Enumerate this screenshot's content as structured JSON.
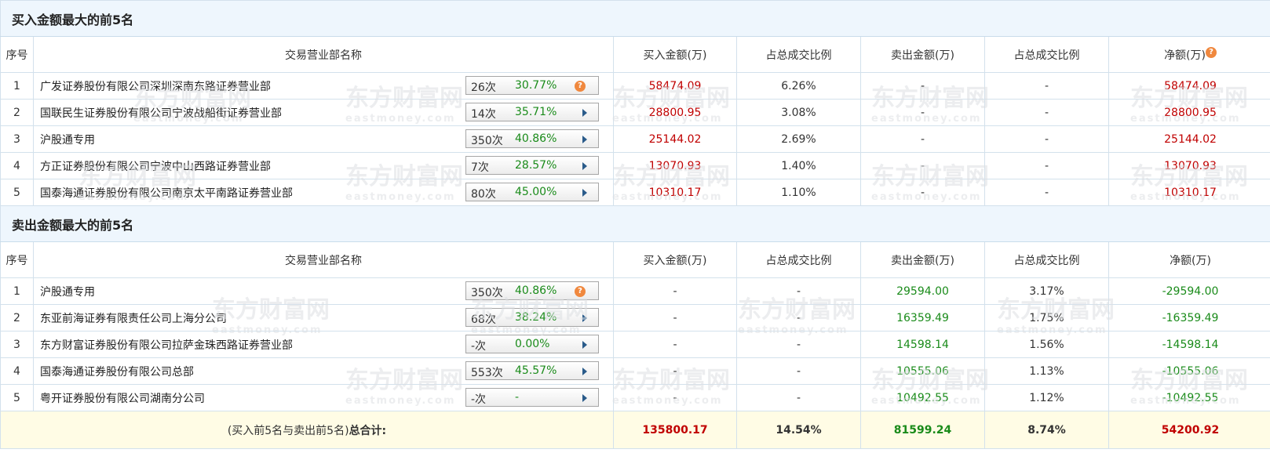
{
  "buy_section": {
    "title": "买入金额最大的前5名",
    "headers": [
      "序号",
      "交易营业部名称",
      "买入金额(万)",
      "占总成交比例",
      "卖出金额(万)",
      "占总成交比例",
      "净额(万)"
    ],
    "rows": [
      {
        "idx": "1",
        "name": "广发证券股份有限公司深圳深南东路证券营业部",
        "count": "26次",
        "pct": "30.77%",
        "icon": "question-icon",
        "buy": "58474.09",
        "buy_ratio": "6.26%",
        "sell": "-",
        "sell_ratio": "-",
        "net": "58474.09"
      },
      {
        "idx": "2",
        "name": "国联民生证券股份有限公司宁波战船街证券营业部",
        "count": "14次",
        "pct": "35.71%",
        "icon": "arrow-right-icon",
        "buy": "28800.95",
        "buy_ratio": "3.08%",
        "sell": "-",
        "sell_ratio": "-",
        "net": "28800.95"
      },
      {
        "idx": "3",
        "name": "沪股通专用",
        "count": "350次",
        "pct": "40.86%",
        "icon": "arrow-right-icon",
        "buy": "25144.02",
        "buy_ratio": "2.69%",
        "sell": "-",
        "sell_ratio": "-",
        "net": "25144.02"
      },
      {
        "idx": "4",
        "name": "方正证券股份有限公司宁波中山西路证券营业部",
        "count": "7次",
        "pct": "28.57%",
        "icon": "arrow-right-icon",
        "buy": "13070.93",
        "buy_ratio": "1.40%",
        "sell": "-",
        "sell_ratio": "-",
        "net": "13070.93"
      },
      {
        "idx": "5",
        "name": "国泰海通证券股份有限公司南京太平南路证券营业部",
        "count": "80次",
        "pct": "45.00%",
        "icon": "arrow-right-icon",
        "buy": "10310.17",
        "buy_ratio": "1.10%",
        "sell": "-",
        "sell_ratio": "-",
        "net": "10310.17"
      }
    ]
  },
  "sell_section": {
    "title": "卖出金额最大的前5名",
    "headers": [
      "序号",
      "交易营业部名称",
      "买入金额(万)",
      "占总成交比例",
      "卖出金额(万)",
      "占总成交比例",
      "净额(万)"
    ],
    "rows": [
      {
        "idx": "1",
        "name": "沪股通专用",
        "count": "350次",
        "pct": "40.86%",
        "icon": "question-icon",
        "buy": "-",
        "buy_ratio": "-",
        "sell": "29594.00",
        "sell_ratio": "3.17%",
        "net": "-29594.00"
      },
      {
        "idx": "2",
        "name": "东亚前海证券有限责任公司上海分公司",
        "count": "68次",
        "pct": "38.24%",
        "icon": "arrow-right-icon",
        "buy": "-",
        "buy_ratio": "-",
        "sell": "16359.49",
        "sell_ratio": "1.75%",
        "net": "-16359.49"
      },
      {
        "idx": "3",
        "name": "东方财富证券股份有限公司拉萨金珠西路证券营业部",
        "count": "-次",
        "pct": "0.00%",
        "icon": "arrow-right-icon",
        "buy": "-",
        "buy_ratio": "-",
        "sell": "14598.14",
        "sell_ratio": "1.56%",
        "net": "-14598.14"
      },
      {
        "idx": "4",
        "name": "国泰海通证券股份有限公司总部",
        "count": "553次",
        "pct": "45.57%",
        "icon": "arrow-right-icon",
        "buy": "-",
        "buy_ratio": "-",
        "sell": "10555.06",
        "sell_ratio": "1.13%",
        "net": "-10555.06"
      },
      {
        "idx": "5",
        "name": "粤开证券股份有限公司湖南分公司",
        "count": "-次",
        "pct": "-",
        "icon": "arrow-right-icon",
        "buy": "-",
        "buy_ratio": "-",
        "sell": "10492.55",
        "sell_ratio": "1.12%",
        "net": "-10492.55"
      }
    ]
  },
  "totals": {
    "label_prefix": "(买入前5名与卖出前5名)",
    "label_bold": "总合计:",
    "buy": "135800.17",
    "buy_ratio": "14.54%",
    "sell": "81599.24",
    "sell_ratio": "8.74%",
    "net": "54200.92"
  },
  "net_help_glyph": "?",
  "watermark": {
    "cn": "东方财富网",
    "en": "eastmoney.com"
  },
  "colors": {
    "buy": "#c00000",
    "sell": "#1a8b1a",
    "header_bg": "#eef6fd",
    "total_bg": "#fffce5"
  }
}
